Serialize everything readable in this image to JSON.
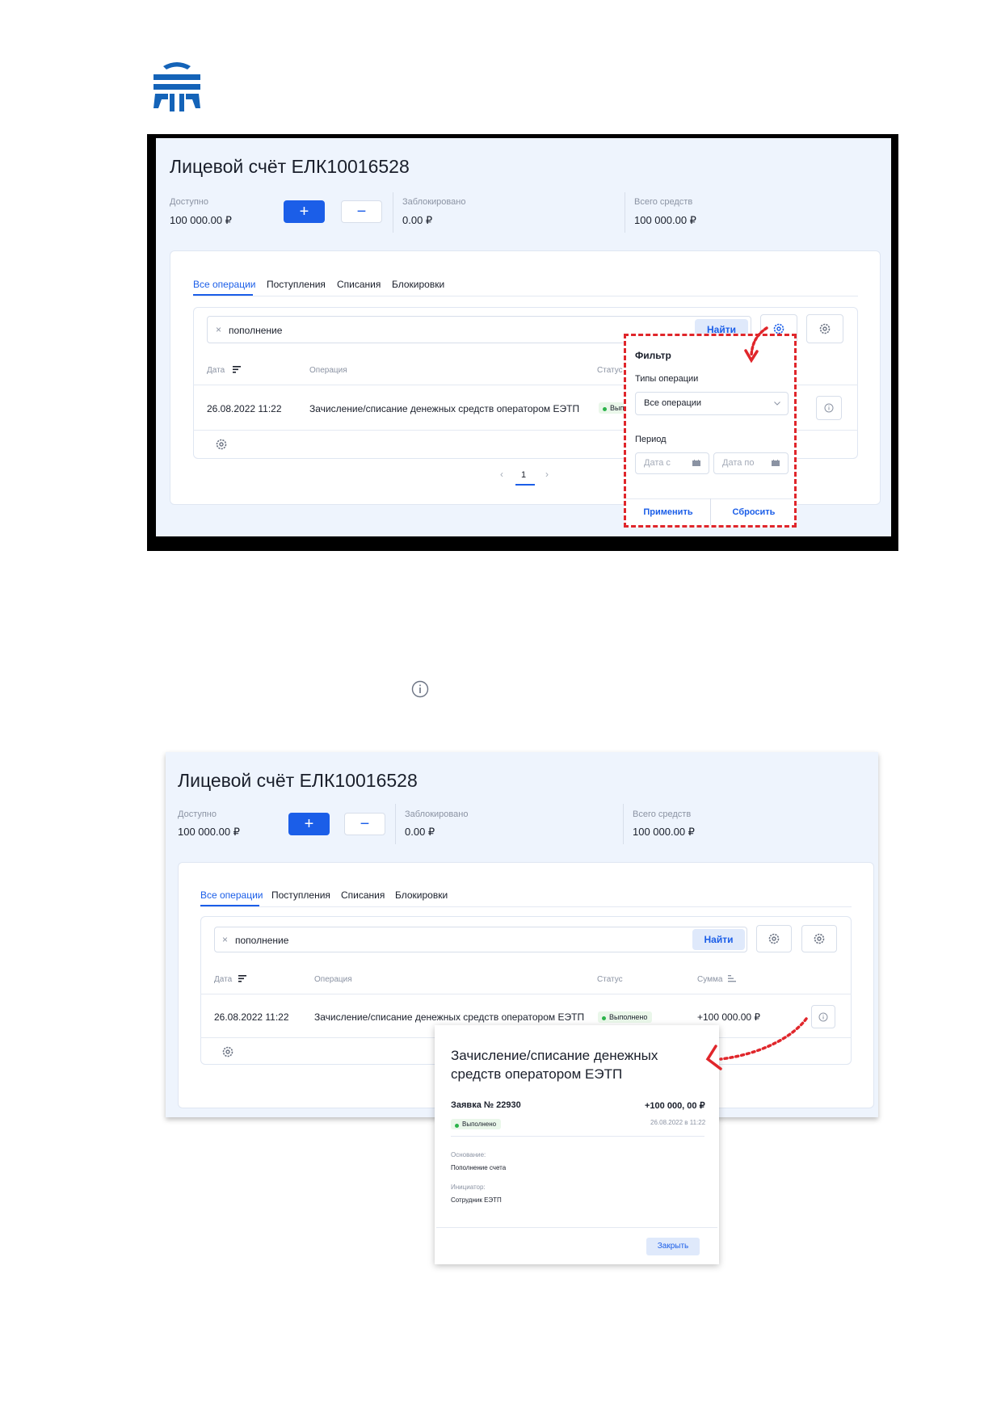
{
  "screen1": {
    "title": "Лицевой счёт ЕЛК10016528",
    "available_label": "Доступно",
    "available_value": "100 000.00 ₽",
    "plus_label": "+",
    "minus_label": "−",
    "blocked_label": "Заблокировано",
    "blocked_value": "0.00 ₽",
    "total_label": "Всего средств",
    "total_value": "100 000.00 ₽",
    "tabs": [
      "Все операции",
      "Поступления",
      "Списания",
      "Блокировки"
    ],
    "search_value": "пополнение",
    "search_clear": "×",
    "find_button": "Найти",
    "columns": [
      "Дата",
      "Операция",
      "Статус"
    ],
    "row": {
      "date": "26.08.2022 11:22",
      "operation": "Зачисление/списание денежных средств оператором ЕЭТП",
      "status": "Вып"
    },
    "pagination": {
      "prev": "‹",
      "page": "1",
      "next": "›"
    },
    "filter": {
      "title": "Фильтр",
      "types_label": "Типы операции",
      "types_value": "Все операции",
      "period_label": "Период",
      "date_from": "Дата с",
      "date_to": "Дата по",
      "apply": "Применить",
      "reset": "Сбросить"
    }
  },
  "screen2": {
    "title": "Лицевой счёт ЕЛК10016528",
    "available_label": "Доступно",
    "available_value": "100 000.00 ₽",
    "plus_label": "+",
    "minus_label": "−",
    "blocked_label": "Заблокировано",
    "blocked_value": "0.00 ₽",
    "total_label": "Всего средств",
    "total_value": "100 000.00 ₽",
    "tabs": [
      "Все операции",
      "Поступления",
      "Списания",
      "Блокировки"
    ],
    "search_value": "пополнение",
    "search_clear": "×",
    "find_button": "Найти",
    "columns": [
      "Дата",
      "Операция",
      "Статус",
      "Сумма"
    ],
    "row": {
      "date": "26.08.2022 11:22",
      "operation": "Зачисление/списание денежных средств оператором ЕЭТП",
      "status": "Выполнено",
      "amount": "+100 000.00 ₽"
    },
    "modal": {
      "title": "Зачисление/списание денежных средств оператором ЕЭТП",
      "request": "Заявка № 22930",
      "amount": "+100 000, 00 ₽",
      "status": "Выполнено",
      "datetime": "26.08.2022 в 11:22",
      "basis_label": "Основание:",
      "basis_value": "Пополнение счета",
      "initiator_label": "Инициатор:",
      "initiator_value": "Сотрудник ЕЭТП",
      "close": "Закрыть"
    }
  },
  "colors": {
    "accent": "#1b5ee8",
    "annotation": "#e0262b",
    "logo": "#1463b8"
  }
}
